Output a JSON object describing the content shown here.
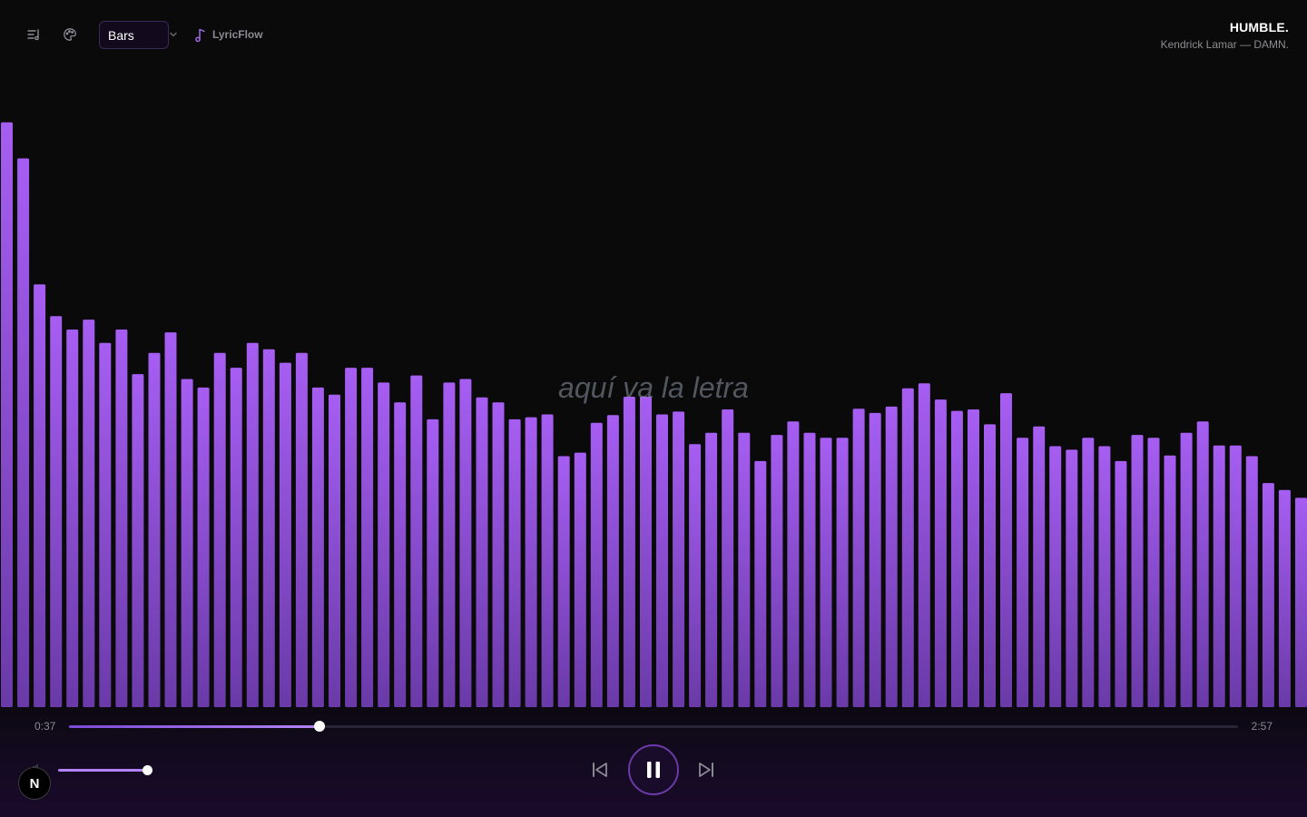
{
  "toolbar": {
    "lyrics_icon": "lyrics-list-icon",
    "theme_icon": "palette-icon",
    "mode_select": {
      "value": "Bars",
      "icon": "chevron-down-icon"
    },
    "brand": {
      "name": "LyricFlow",
      "icon": "music-note-icon"
    }
  },
  "track": {
    "title": "HUMBLE.",
    "artist_album": "Kendrick Lamar — DAMN."
  },
  "lyric_placeholder": "aquí va la letra",
  "colors": {
    "background": "#0a0a0a",
    "bar_top": "#a45cf0",
    "bar_bottom": "#6a3aa8",
    "accent": "#b384f5"
  },
  "visualizer": {
    "mode": "Bars",
    "levels": [
      0.827,
      0.776,
      0.598,
      0.553,
      0.534,
      0.548,
      0.515,
      0.534,
      0.471,
      0.501,
      0.53,
      0.464,
      0.452,
      0.501,
      0.48,
      0.515,
      0.506,
      0.487,
      0.501,
      0.452,
      0.442,
      0.48,
      0.48,
      0.459,
      0.431,
      0.469,
      0.407,
      0.459,
      0.464,
      0.438,
      0.431,
      0.407,
      0.41,
      0.414,
      0.355,
      0.36,
      0.402,
      0.413,
      0.439,
      0.439,
      0.414,
      0.418,
      0.372,
      0.388,
      0.421,
      0.388,
      0.348,
      0.385,
      0.404,
      0.388,
      0.381,
      0.381,
      0.422,
      0.416,
      0.425,
      0.451,
      0.458,
      0.435,
      0.419,
      0.421,
      0.4,
      0.444,
      0.381,
      0.397,
      0.369,
      0.364,
      0.381,
      0.369,
      0.348,
      0.385,
      0.381,
      0.356,
      0.388,
      0.404,
      0.37,
      0.37,
      0.355,
      0.317,
      0.307,
      0.296
    ]
  },
  "player": {
    "current_time": "0:37",
    "total_time": "2:57",
    "progress": 0.214,
    "volume": 1.0,
    "volume_icon": "volume-icon",
    "prev_icon": "skip-previous-icon",
    "play_pause_icon": "pause-icon",
    "next_icon": "skip-next-icon"
  },
  "overlay_badge": {
    "label": "N"
  }
}
